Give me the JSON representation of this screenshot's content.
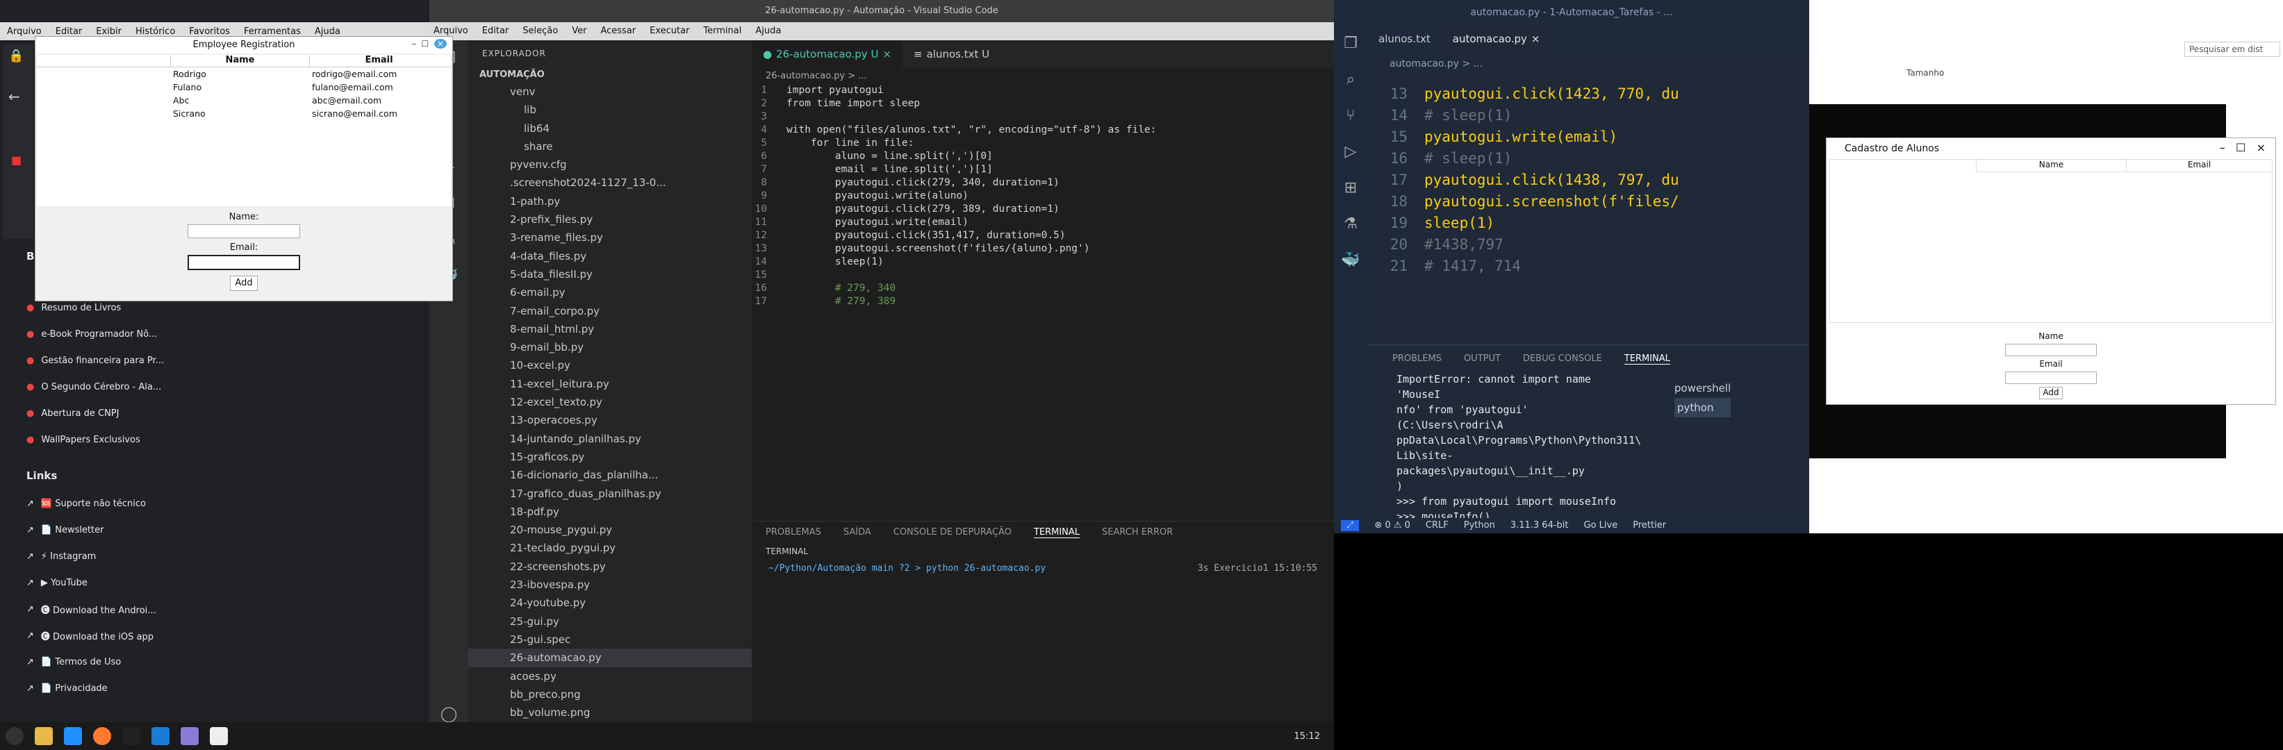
{
  "browser": {
    "menu": [
      "Arquivo",
      "Editar",
      "Exibir",
      "Histórico",
      "Favoritos",
      "Ferramentas",
      "Ajuda"
    ],
    "bookmarks": [
      "Resumo de Livros",
      "e-Book Programador Nô...",
      "Gestão financeira para Pr...",
      "O Segundo Cérebro - Ala...",
      "Abertura de CNPJ",
      "WallPapers Exclusivos"
    ],
    "links_title": "Links",
    "links": [
      "🆘 Suporte não técnico",
      "📄 Newsletter",
      "⚡ Instagram",
      "▶ YouTube",
      "🅒 Download the Androi...",
      "🅒 Download the iOS app",
      "📄 Termos de Uso",
      "📄 Privacidade"
    ],
    "frag_b": "B"
  },
  "employee_dialog": {
    "title": "Employee Registration",
    "col_name": "Name",
    "col_email": "Email",
    "rows": [
      [
        "Rodrigo",
        "rodrigo@email.com"
      ],
      [
        "Fulano",
        "fulano@email.com"
      ],
      [
        "Abc",
        "abc@email.com"
      ],
      [
        "Sicrano",
        "sicrano@email.com"
      ]
    ],
    "name_label": "Name:",
    "email_label": "Email:",
    "add_label": "Add"
  },
  "vscode": {
    "title": "26-automacao.py - Automação - Visual Studio Code",
    "menu": [
      "Arquivo",
      "Editar",
      "Seleção",
      "Ver",
      "Acessar",
      "Executar",
      "Terminal",
      "Ajuda"
    ],
    "explorer_title": "EXPLORADOR",
    "folder": "AUTOMAÇÃO",
    "files": [
      "venv",
      "lib",
      "lib64",
      "share",
      "pyvenv.cfg",
      ".screenshot2024-1127_13-0...",
      "1-path.py",
      "2-prefix_files.py",
      "3-rename_files.py",
      "4-data_files.py",
      "5-data_filesII.py",
      "6-email.py",
      "7-email_corpo.py",
      "8-email_html.py",
      "9-email_bb.py",
      "10-excel.py",
      "11-excel_leitura.py",
      "12-excel_texto.py",
      "13-operacoes.py",
      "14-juntando_planilhas.py",
      "15-graficos.py",
      "16-dicionario_das_planilha...",
      "17-grafico_duas_planilhas.py",
      "18-pdf.py",
      "20-mouse_pygui.py",
      "21-teclado_pygui.py",
      "22-screenshots.py",
      "23-ibovespa.py",
      "24-youtube.py",
      "25-gui.py",
      "25-gui.spec",
      "26-automacao.py",
      "acoes.py",
      "bb_preco.png",
      "bb_volume.png"
    ],
    "tabs": [
      "26-automacao.py U",
      "alunos.txt U"
    ],
    "breadcrumb": "26-automacao.py > ...",
    "code": [
      "import pyautogui",
      "from time import sleep",
      "",
      "with open(\"files/alunos.txt\", \"r\", encoding=\"utf-8\") as file:",
      "    for line in file:",
      "        aluno = line.split(',')[0]",
      "        email = line.split(',')[1]",
      "        pyautogui.click(279, 340, duration=1)",
      "        pyautogui.write(aluno)",
      "        pyautogui.click(279, 389, duration=1)",
      "        pyautogui.write(email)",
      "        pyautogui.click(351,417, duration=0.5)",
      "        pyautogui.screenshot(f'files/{aluno}.png')",
      "        sleep(1)",
      "",
      "        # 279, 340",
      "        # 279, 389"
    ],
    "panel_tabs": [
      "PROBLEMAS",
      "SAÍDA",
      "CONSOLE DE DEPURAÇÃO",
      "TERMINAL",
      "SEARCH ERROR"
    ],
    "terminal_label": "TERMINAL",
    "prompt": "~/Python/Automação  main ?2 > python 26-automacao.py",
    "prompt_right": "3s  Exercicio1  15:10:55"
  },
  "taskbar": {
    "time": "15:12"
  },
  "vscode2": {
    "title": "automacao.py - 1-Automacao_Tarefas - ...",
    "tabs": [
      "alunos.txt",
      "automacao.py"
    ],
    "breadcrumb": "automacao.py > ...",
    "lines": [
      {
        "n": "13",
        "t": "pyautogui.click(1423, 770, du"
      },
      {
        "n": "14",
        "t": "# sleep(1)"
      },
      {
        "n": "15",
        "t": "pyautogui.write(email)"
      },
      {
        "n": "16",
        "t": "# sleep(1)"
      },
      {
        "n": "17",
        "t": "pyautogui.click(1438, 797, du"
      },
      {
        "n": "18",
        "t": "pyautogui.screenshot(f'files/"
      },
      {
        "n": "19",
        "t": "sleep(1)"
      },
      {
        "n": "20",
        "t": "#1438,797"
      },
      {
        "n": "21",
        "t": "# 1417, 714"
      }
    ],
    "panel_tabs": [
      "PROBLEMS",
      "OUTPUT",
      "DEBUG CONSOLE",
      "TERMINAL"
    ],
    "terminal": [
      "ImportError: cannot import name 'MouseI",
      "nfo' from 'pyautogui' (C:\\Users\\rodri\\A",
      "ppData\\Local\\Programs\\Python\\Python311\\",
      "Lib\\site-packages\\pyautogui\\__init__.py",
      ")",
      ">>> from pyautogui import mouseInfo",
      ">>> mouseInfo()"
    ],
    "shells": [
      "powershell",
      "python"
    ],
    "status": [
      "⊗ 0 ⚠ 0",
      "CRLF",
      "Python",
      "3.11.3 64-bit",
      "Go Live",
      "Prettier"
    ]
  },
  "cadastro": {
    "title": "Cadastro de Alunos",
    "col_name": "Name",
    "col_email": "Email",
    "name_label": "Name",
    "email_label": "Email",
    "add_label": "Add"
  },
  "right_browser": {
    "search_placeholder": "Pesquisar em dist",
    "col": "Tamanho"
  }
}
